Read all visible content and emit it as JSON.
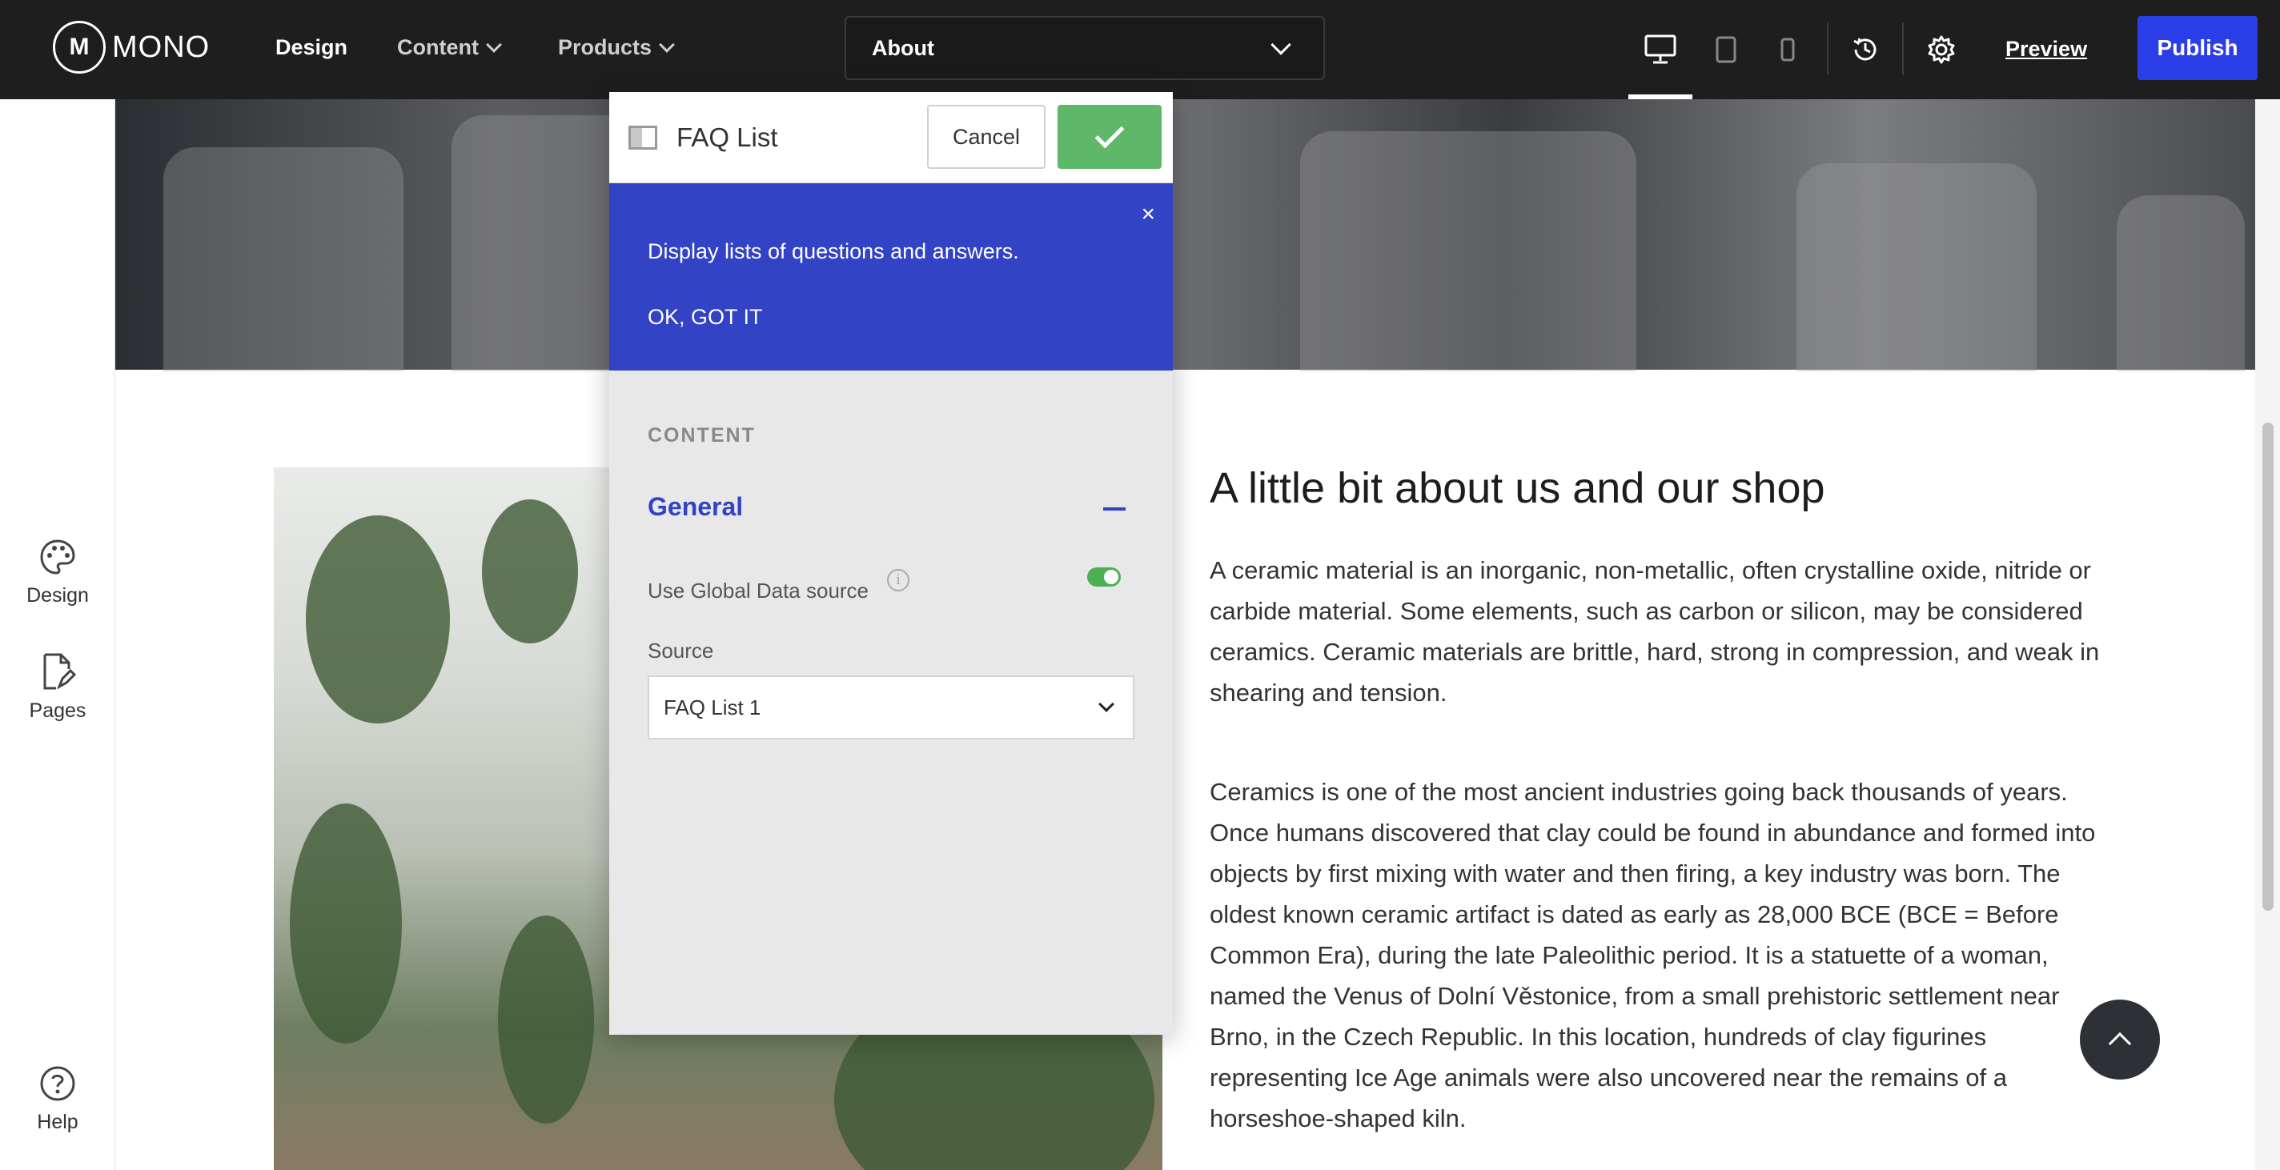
{
  "app": {
    "logo_text": "MONO",
    "logo_mark": "M"
  },
  "nav": {
    "design": "Design",
    "content": "Content",
    "products": "Products"
  },
  "page_selector": {
    "value": "About"
  },
  "toolbar": {
    "preview_label": "Preview",
    "publish_label": "Publish",
    "devices": [
      "desktop-icon",
      "tablet-icon",
      "mobile-icon"
    ],
    "active_device": "desktop"
  },
  "rail": {
    "design": "Design",
    "pages": "Pages",
    "help": "Help"
  },
  "panel": {
    "title": "FAQ List",
    "cancel_label": "Cancel",
    "tip": {
      "text": "Display lists of questions and answers.",
      "ok_label": "OK, GOT IT",
      "close_glyph": "×"
    },
    "section_label": "CONTENT",
    "group_title": "General",
    "toggle_label": "Use Global Data source",
    "toggle_on": true,
    "info_glyph": "i",
    "source_label": "Source",
    "source_value": "FAQ List 1"
  },
  "page": {
    "about_title": "A little bit about us and our shop",
    "paragraph_1": "A ceramic material is an inorganic, non-metallic, often crystalline oxide, nitride or carbide material. Some elements, such as carbon or silicon, may be considered ceramics. Ceramic materials are brittle, hard, strong in compression, and weak in shearing and tension.",
    "paragraph_2": "Ceramics is one of the most ancient industries going back thousands of years. Once humans discovered that clay could be found in abundance and formed into objects by first mixing with water and then firing, a key industry was born. The oldest known ceramic artifact is dated as early as 28,000 BCE (BCE = Before Common Era), during the late Paleolithic period. It is a statuette of a woman, named the Venus of Dolní Věstonice, from a small prehistoric settlement near Brno, in the Czech Republic. In this location, hundreds of clay figurines representing Ice Age animals were also uncovered near the remains of a horseshoe-shaped kiln."
  },
  "colors": {
    "accent": "#3343c5",
    "publish": "#2a3ee8",
    "confirm": "#5fb86a",
    "topbar": "#1e1e1e"
  }
}
